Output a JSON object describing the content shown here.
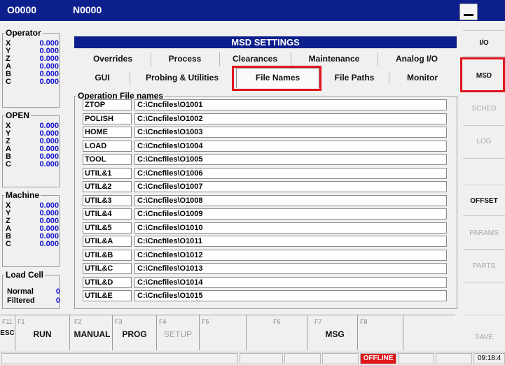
{
  "topbar": {
    "program": "O0000",
    "sequence": "N0000"
  },
  "left": {
    "operator": {
      "title": "Operator",
      "axes": [
        {
          "axis": "X",
          "value": "0.000"
        },
        {
          "axis": "Y",
          "value": "0.000"
        },
        {
          "axis": "Z",
          "value": "0.000"
        },
        {
          "axis": "A",
          "value": "0.000"
        },
        {
          "axis": "B",
          "value": "0.000"
        },
        {
          "axis": "C",
          "value": "0.000"
        }
      ]
    },
    "open": {
      "title": "OPEN",
      "axes": [
        {
          "axis": "X",
          "value": "0.000"
        },
        {
          "axis": "Y",
          "value": "0.000"
        },
        {
          "axis": "Z",
          "value": "0.000"
        },
        {
          "axis": "A",
          "value": "0.000"
        },
        {
          "axis": "B",
          "value": "0.000"
        },
        {
          "axis": "C",
          "value": "0.000"
        }
      ]
    },
    "machine": {
      "title": "Machine",
      "axes": [
        {
          "axis": "X",
          "value": "0.000"
        },
        {
          "axis": "Y",
          "value": "0.000"
        },
        {
          "axis": "Z",
          "value": "0.000"
        },
        {
          "axis": "A",
          "value": "0.000"
        },
        {
          "axis": "B",
          "value": "0.000"
        },
        {
          "axis": "C",
          "value": "0.000"
        }
      ]
    },
    "loadcell": {
      "title": "Load Cell",
      "rows": [
        {
          "label": "Normal",
          "value": "0"
        },
        {
          "label": "Filtered",
          "value": "0"
        }
      ]
    }
  },
  "main": {
    "header": "MSD SETTINGS",
    "tabs_row1": [
      "Overrides",
      "Process",
      "Clearances",
      "Maintenance",
      "Analog I/O"
    ],
    "tabs_row2": [
      "GUI",
      "Probing & Utilities",
      "File Names",
      "File Paths",
      "Monitor"
    ],
    "active_tab": "File Names",
    "section_title": "Operation File names",
    "files": [
      {
        "name": "ZTOP",
        "path": "C:\\Cncfiles\\O1001"
      },
      {
        "name": "POLISH",
        "path": "C:\\Cncfiles\\O1002"
      },
      {
        "name": "HOME",
        "path": "C:\\Cncfiles\\O1003"
      },
      {
        "name": "LOAD",
        "path": "C:\\Cncfiles\\O1004"
      },
      {
        "name": "TOOL",
        "path": "C:\\Cncfiles\\O1005"
      },
      {
        "name": "UTIL&1",
        "path": "C:\\Cncfiles\\O1006"
      },
      {
        "name": "UTIL&2",
        "path": "C:\\Cncfiles\\O1007"
      },
      {
        "name": "UTIL&3",
        "path": "C:\\Cncfiles\\O1008"
      },
      {
        "name": "UTIL&4",
        "path": "C:\\Cncfiles\\O1009"
      },
      {
        "name": "UTIL&5",
        "path": "C:\\Cncfiles\\O1010"
      },
      {
        "name": "UTIL&A",
        "path": "C:\\Cncfiles\\O1011"
      },
      {
        "name": "UTIL&B",
        "path": "C:\\Cncfiles\\O1012"
      },
      {
        "name": "UTIL&C",
        "path": "C:\\Cncfiles\\O1013"
      },
      {
        "name": "UTIL&D",
        "path": "C:\\Cncfiles\\O1014"
      },
      {
        "name": "UTIL&E",
        "path": "C:\\Cncfiles\\O1015"
      }
    ]
  },
  "right_buttons": [
    {
      "label": "I/O",
      "enabled": true
    },
    {
      "label": "MSD",
      "enabled": true,
      "highlighted": true
    },
    {
      "label": "SCHED",
      "enabled": false
    },
    {
      "label": "LOG",
      "enabled": false
    },
    {
      "label": "OFFSET",
      "enabled": true
    },
    {
      "label": "PARAMS",
      "enabled": false
    },
    {
      "label": "PARTS",
      "enabled": false
    },
    {
      "label": "SAVE",
      "enabled": false
    }
  ],
  "fkeys": [
    {
      "fn": "F11",
      "label": "ESC",
      "enabled": true
    },
    {
      "fn": "F1",
      "label": "RUN",
      "enabled": true
    },
    {
      "fn": "F2",
      "label": "MANUAL",
      "enabled": true
    },
    {
      "fn": "F3",
      "label": "PROG",
      "enabled": true
    },
    {
      "fn": "F4",
      "label": "SETUP",
      "enabled": false
    },
    {
      "fn": "F5",
      "label": "",
      "enabled": false
    },
    {
      "fn": "F6",
      "label": "",
      "enabled": false
    },
    {
      "fn": "F7",
      "label": "MSG",
      "enabled": true
    },
    {
      "fn": "F8",
      "label": "",
      "enabled": false
    }
  ],
  "status": {
    "connection": "OFFLINE",
    "time": "09:18:4",
    "offline_color": "#e0141b"
  },
  "colors": {
    "titlebar": "#0c1f8c",
    "value_blue": "#1010d0",
    "highlight": "#e0141b"
  }
}
